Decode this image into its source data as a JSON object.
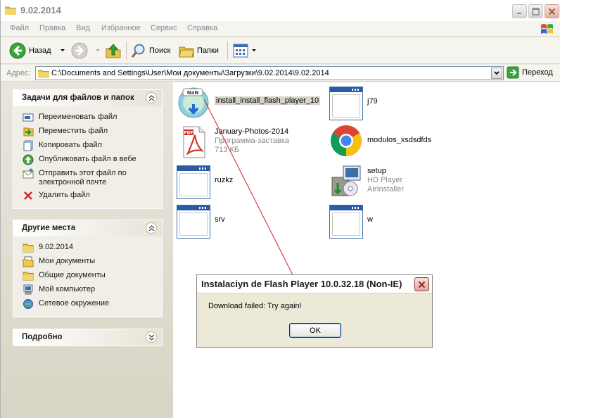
{
  "window": {
    "title": "9.02.2014",
    "icons": {
      "folder": "folder-icon",
      "minimize": "minimize-icon",
      "maximize": "maximize-icon",
      "close": "close-icon"
    }
  },
  "menu": [
    "Файл",
    "Правка",
    "Вид",
    "Избранное",
    "Сервис",
    "Справка"
  ],
  "toolbar": {
    "back_label": "Назад",
    "search_label": "Поиск",
    "folders_label": "Папки"
  },
  "address": {
    "label": "Адрес:",
    "path": "C:\\Documents and Settings\\User\\Мои документы\\Загрузки\\9.02.2014\\9.02.2014",
    "go_label": "Переход"
  },
  "tasks_panel": {
    "title": "Задачи для файлов и папок",
    "items": [
      {
        "label": "Переименовать файл",
        "icon": "rename-icon"
      },
      {
        "label": "Переместить файл",
        "icon": "move-file-icon"
      },
      {
        "label": "Копировать файл",
        "icon": "copy-file-icon"
      },
      {
        "label": "Опубликовать файл в вебе",
        "icon": "publish-web-icon"
      },
      {
        "label": "Отправить этот файл по электронной почте",
        "icon": "email-icon"
      },
      {
        "label": "Удалить файл",
        "icon": "delete-icon"
      }
    ]
  },
  "places_panel": {
    "title": "Другие места",
    "items": [
      {
        "label": "9.02.2014",
        "icon": "folder-icon"
      },
      {
        "label": "Мои документы",
        "icon": "my-documents-icon"
      },
      {
        "label": "Общие документы",
        "icon": "shared-documents-icon"
      },
      {
        "label": "Мой компьютер",
        "icon": "my-computer-icon"
      },
      {
        "label": "Сетевое окружение",
        "icon": "network-icon"
      }
    ]
  },
  "details_panel": {
    "title": "Подробно"
  },
  "files": [
    {
      "name": "install_install_flash_player_10",
      "icon": "flash-installer-icon",
      "selected": true
    },
    {
      "name": "j79",
      "icon": "application-icon"
    },
    {
      "name": "January-Photos-2014",
      "sub1": "Программа-заставка",
      "sub2": "713 КБ",
      "icon": "pdf-screensaver-icon"
    },
    {
      "name": "modulos_xsdsdfds",
      "icon": "chrome-icon"
    },
    {
      "name": "ruzkz",
      "icon": "application-icon"
    },
    {
      "name": "setup",
      "sub1": "HD Player",
      "sub2": "AirInstaller",
      "icon": "setup-installer-icon"
    },
    {
      "name": "srv",
      "icon": "application-icon"
    },
    {
      "name": "w",
      "icon": "application-icon"
    }
  ],
  "dialog": {
    "title": "Instalaciyn de Flash Player 10.0.32.18 (Non-IE)",
    "message": "Download failed: Try again!",
    "ok_label": "OK"
  }
}
